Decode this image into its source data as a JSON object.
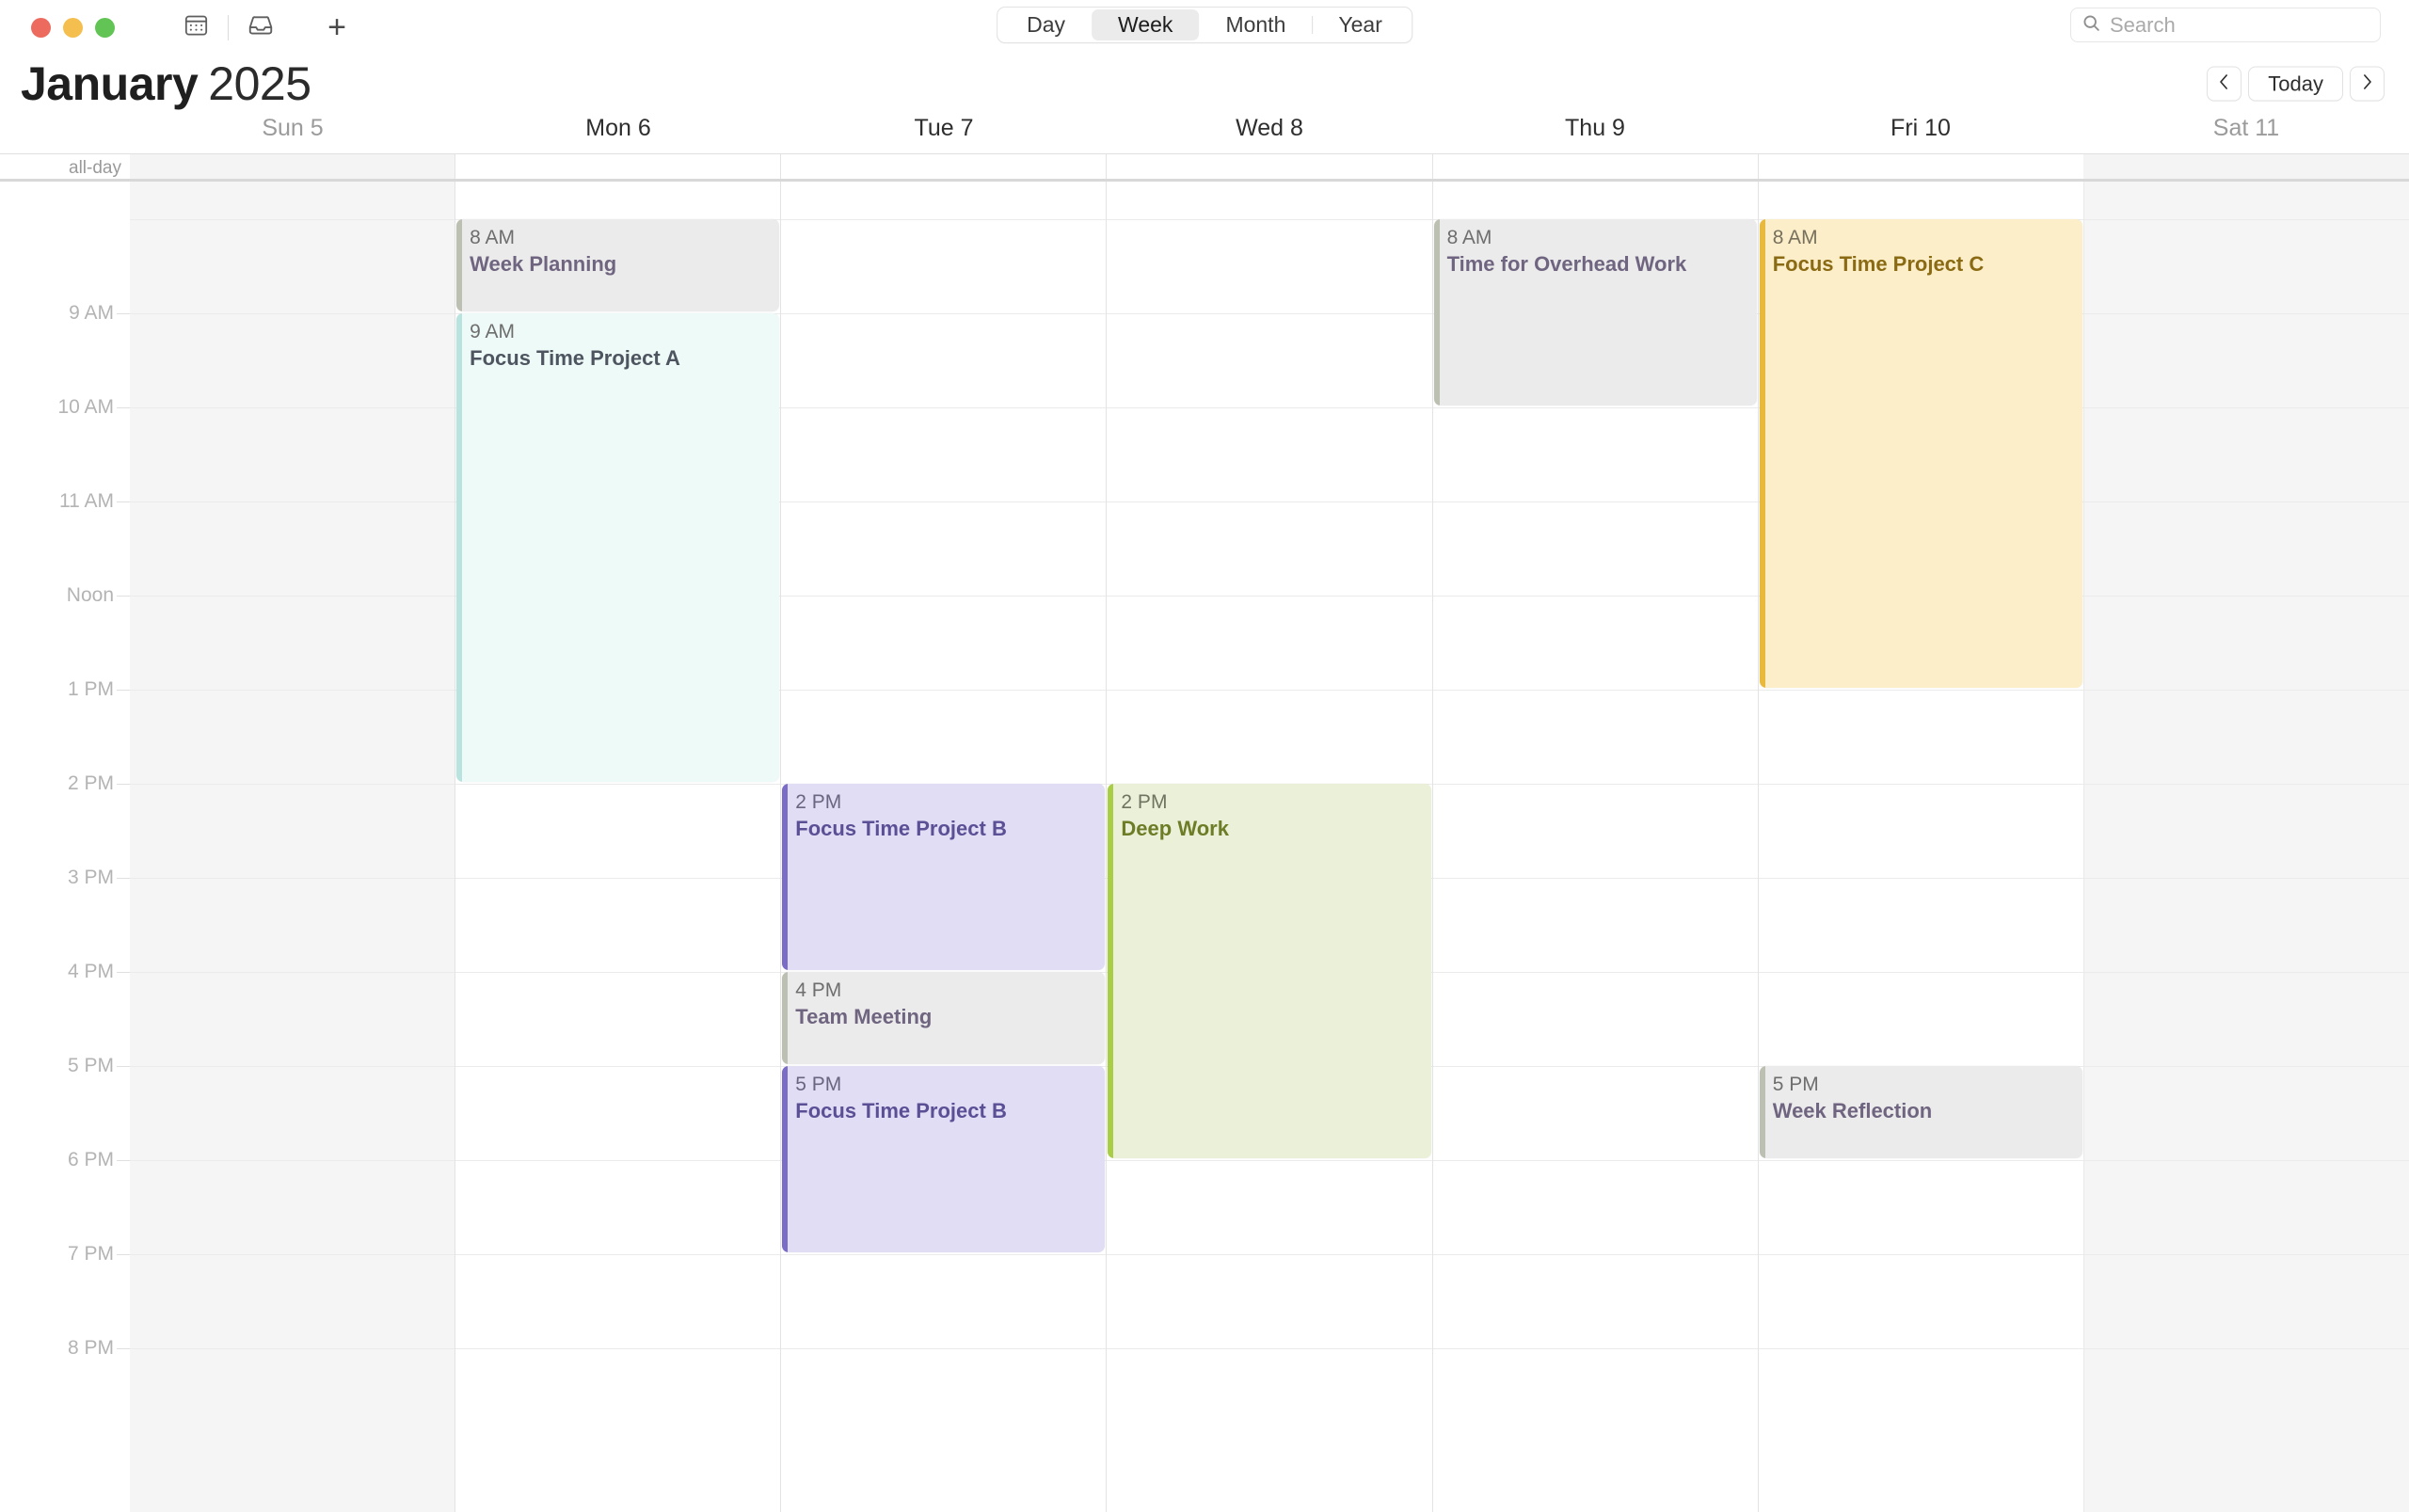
{
  "window": {
    "traffic_lights": [
      {
        "name": "close",
        "color": "#ed6a5f"
      },
      {
        "name": "minimize",
        "color": "#f4bf4f"
      },
      {
        "name": "maximize",
        "color": "#61c454"
      }
    ],
    "toolbar_icons": [
      "calendar-icon",
      "inbox-icon",
      "add-icon"
    ]
  },
  "view_switcher": {
    "options": [
      "Day",
      "Week",
      "Month",
      "Year"
    ],
    "selected": "Week"
  },
  "search": {
    "placeholder": "Search",
    "value": "",
    "icon": "search-icon"
  },
  "header": {
    "month": "January",
    "year": "2025",
    "prev_label": "‹",
    "today_label": "Today",
    "next_label": "›"
  },
  "allday": {
    "label": "all-day"
  },
  "days": [
    {
      "label": "Sun 5",
      "weekend": true
    },
    {
      "label": "Mon 6",
      "weekend": false
    },
    {
      "label": "Tue 7",
      "weekend": false
    },
    {
      "label": "Wed 8",
      "weekend": false
    },
    {
      "label": "Thu 9",
      "weekend": false
    },
    {
      "label": "Fri 10",
      "weekend": false
    },
    {
      "label": "Sat 11",
      "weekend": true
    }
  ],
  "time_labels": [
    "9 AM",
    "10 AM",
    "11 AM",
    "Noon",
    "1 PM",
    "2 PM",
    "3 PM",
    "4 PM",
    "5 PM",
    "6 PM",
    "7 PM",
    "8 PM"
  ],
  "grid": {
    "start_hour": 7.6,
    "end_hour": 20.5,
    "hour_height": 100
  },
  "events": [
    {
      "id": "e1",
      "day": 1,
      "start": 8,
      "end": 9,
      "time": "8 AM",
      "title": "Week Planning",
      "color": "gray",
      "accent": "#bcc0b3",
      "bg": "#ecebeb"
    },
    {
      "id": "e2",
      "day": 1,
      "start": 9,
      "end": 14,
      "time": "9 AM",
      "title": "Focus Time Project A",
      "color": "teal",
      "accent": "#b9e3de",
      "bg": "#eefaf7"
    },
    {
      "id": "e3",
      "day": 2,
      "start": 14,
      "end": 16,
      "time": "2 PM",
      "title": "Focus Time Project B",
      "color": "purple",
      "accent": "#7b6cc8",
      "bg": "#e0ddf4"
    },
    {
      "id": "e4",
      "day": 2,
      "start": 16,
      "end": 17,
      "time": "4 PM",
      "title": "Team Meeting",
      "color": "gray",
      "accent": "#bcc0b3",
      "bg": "#ecebeb"
    },
    {
      "id": "e5",
      "day": 2,
      "start": 17,
      "end": 19,
      "time": "5 PM",
      "title": "Focus Time Project B",
      "color": "purple",
      "accent": "#7b6cc8",
      "bg": "#e0ddf4"
    },
    {
      "id": "e6",
      "day": 3,
      "start": 14,
      "end": 18,
      "time": "2 PM",
      "title": "Deep Work",
      "color": "green",
      "accent": "#a9cd45",
      "bg": "#ebf1d8"
    },
    {
      "id": "e7",
      "day": 4,
      "start": 8,
      "end": 10,
      "time": "8 AM",
      "title": "Time for Overhead Work",
      "color": "gray",
      "accent": "#bcc0b3",
      "bg": "#ecebeb"
    },
    {
      "id": "e8",
      "day": 5,
      "start": 8,
      "end": 13,
      "time": "8 AM",
      "title": "Focus Time Project C",
      "color": "yellow",
      "accent": "#e8b93c",
      "bg": "#fbeec9"
    },
    {
      "id": "e9",
      "day": 5,
      "start": 17,
      "end": 18,
      "time": "5 PM",
      "title": "Week Reflection",
      "color": "gray",
      "accent": "#bcc0b3",
      "bg": "#ecebeb"
    }
  ]
}
